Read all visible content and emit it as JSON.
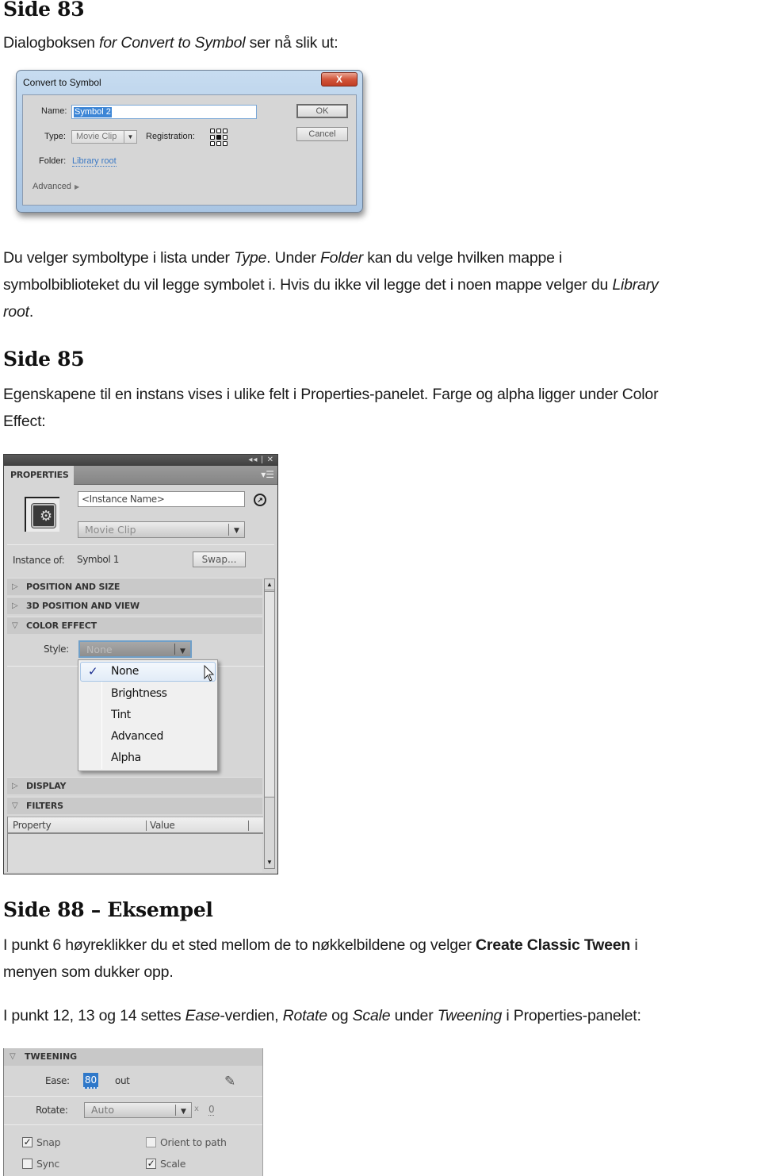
{
  "sections": {
    "side83": {
      "heading": "Side 83",
      "intro_parts": [
        "Dialogboksen ",
        "for Convert to Symbol",
        " ser nå slik ut:"
      ],
      "paragraph_lines": [
        [
          "Du velger symboltype i lista under ",
          "Type",
          ". Under ",
          "Folder",
          " kan du velge hvilken mappe i"
        ],
        [
          "symbolbiblioteket du vil legge symbolet i. Hvis du ikke vil legge det i noen mappe velger du ",
          "Library"
        ],
        [
          "root",
          "."
        ]
      ]
    },
    "side85": {
      "heading": "Side 85",
      "paragraph_lines": [
        "Egenskapene til en instans vises i ulike felt i Properties-panelet. Farge og alpha ligger under Color",
        "Effect:"
      ]
    },
    "side88": {
      "heading": "Side 88 – Eksempel",
      "paragraph1_parts": [
        "I punkt 6 høyreklikker du et sted mellom de to nøkkelbildene og velger ",
        "Create Classic Tween",
        " i"
      ],
      "paragraph1_line2": "menyen som dukker opp.",
      "paragraph2_parts": [
        "I punkt 12, 13 og 14 settes ",
        "Ease",
        "-verdien,  ",
        "Rotate",
        " og ",
        "Scale",
        " under ",
        "Tweening",
        " i Properties-panelet:"
      ]
    }
  },
  "dialog": {
    "title": "Convert to Symbol",
    "close_icon": "close-icon",
    "close_glyph": "X",
    "name_label": "Name:",
    "name_value": "Symbol 2",
    "type_label": "Type:",
    "type_value": "Movie Clip",
    "registration_label": "Registration:",
    "registration_selected": "center",
    "folder_label": "Folder:",
    "folder_value": "Library root",
    "advanced_label": "Advanced",
    "ok_label": "OK",
    "cancel_label": "Cancel"
  },
  "properties_panel": {
    "collapse_glyph": "◂◂",
    "close_glyph": "✕",
    "tab_label": "PROPERTIES",
    "menu_glyph": "▾☰",
    "instance_name_placeholder": "<Instance Name>",
    "symbol_type": "Movie Clip",
    "instance_of_label": "Instance of:",
    "instance_of_value": "Symbol 1",
    "swap_label": "Swap...",
    "sections": [
      {
        "label": "POSITION AND SIZE",
        "expanded": false
      },
      {
        "label": "3D POSITION AND VIEW",
        "expanded": false
      },
      {
        "label": "COLOR EFFECT",
        "expanded": true
      },
      {
        "label": "DISPLAY",
        "expanded": false
      },
      {
        "label": "FILTERS",
        "expanded": true
      }
    ],
    "style_label": "Style:",
    "style_value": "None",
    "style_options": [
      {
        "label": "None",
        "checked": true
      },
      {
        "label": "Brightness",
        "checked": false
      },
      {
        "label": "Tint",
        "checked": false
      },
      {
        "label": "Advanced",
        "checked": false
      },
      {
        "label": "Alpha",
        "checked": false
      }
    ],
    "filters_columns": [
      "Property",
      "Value"
    ]
  },
  "tweening_panel": {
    "section_label": "TWEENING",
    "ease_label": "Ease:",
    "ease_value": "80",
    "ease_direction": "out",
    "rotate_label": "Rotate:",
    "rotate_value": "Auto",
    "rotate_times_glyph": "x",
    "rotate_count": "0",
    "checkboxes": [
      {
        "label": "Snap",
        "checked": true
      },
      {
        "label": "Orient to path",
        "checked": false
      },
      {
        "label": "Sync",
        "checked": false
      },
      {
        "label": "Scale",
        "checked": true
      }
    ]
  },
  "colors": {
    "dialog_link": "#3a78c4",
    "selection_blue": "#3d86d6",
    "check_navy": "#1a2d8f"
  }
}
